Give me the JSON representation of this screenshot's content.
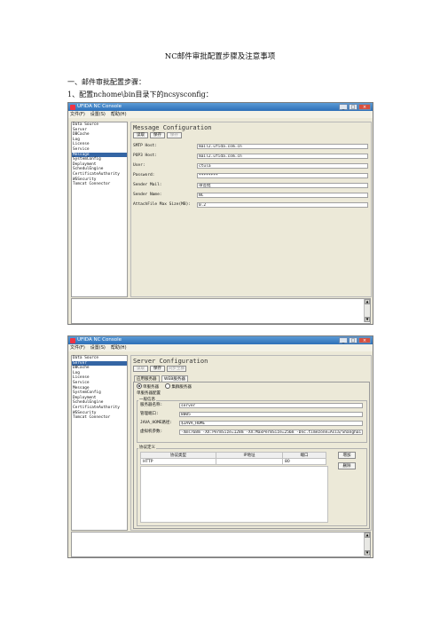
{
  "doc": {
    "title": "NC邮件审批配置步骤及注意事项",
    "section": "一、邮件审批配置步骤：",
    "step1": "1、配置nchome\\bin目录下的ncsysconfig："
  },
  "window": {
    "app_title": "UFIDA NC Console",
    "min": "_",
    "max": "□",
    "close": "×",
    "menu": [
      "文件(F)",
      "设置(S)",
      "帮助(H)"
    ]
  },
  "nav_items": [
    "Data Source",
    "Server",
    "DBCache",
    "Log",
    "License",
    "Service",
    "Message",
    "SystemConfig",
    "Deployment",
    "SchedulEngine",
    "CertificateAuthority",
    "WSSecurity",
    "Tomcat Connector"
  ],
  "shot1": {
    "panel_title": "Message Configuration",
    "buttons": [
      "读取",
      "保存",
      "保存"
    ],
    "fields": [
      {
        "label": "SMTP Host:",
        "value": "mail2.ufida.com.cn"
      },
      {
        "label": "POP3 Host:",
        "value": "mail2.ufida.com.cn"
      },
      {
        "label": "User:",
        "value": "ctula"
      },
      {
        "label": "Password:",
        "value": "********"
      },
      {
        "label": "Sender Mail:",
        "value": "审签批"
      },
      {
        "label": "Sender Name:",
        "value": "NC"
      },
      {
        "label": "AttachFile Max Size(MB):",
        "value": "0.2"
      }
    ]
  },
  "shot2": {
    "panel_title": "Server Configuration",
    "buttons": [
      "读取",
      "保存",
      "同步至群"
    ],
    "tabs": [
      "应用服务器",
      "WEB服务器"
    ],
    "radio_single": "单服务器",
    "radio_cluster": "集群服务器",
    "group_title": "单服务器配置",
    "sub_group": "一般信息",
    "fields": [
      {
        "label": "服务器名称:",
        "value": "server"
      },
      {
        "label": "管理端口:",
        "value": "8005"
      },
      {
        "label": "JAVA_HOME路径:",
        "value": "$JAVA_HOME"
      },
      {
        "label": "虚拟机参数:",
        "value": "-Xms768m -XX:PermSize=128m -XX:MaxPermSize=256m -Dnc.timezone=Asia/Shanghai"
      }
    ],
    "proto_group": "协议定义",
    "proto_headers": [
      "协议类型",
      "IP地址",
      "端口"
    ],
    "proto_rows": [
      [
        "HTTP",
        "",
        "80"
      ]
    ],
    "add_btn": "增加",
    "del_btn": "删除"
  }
}
